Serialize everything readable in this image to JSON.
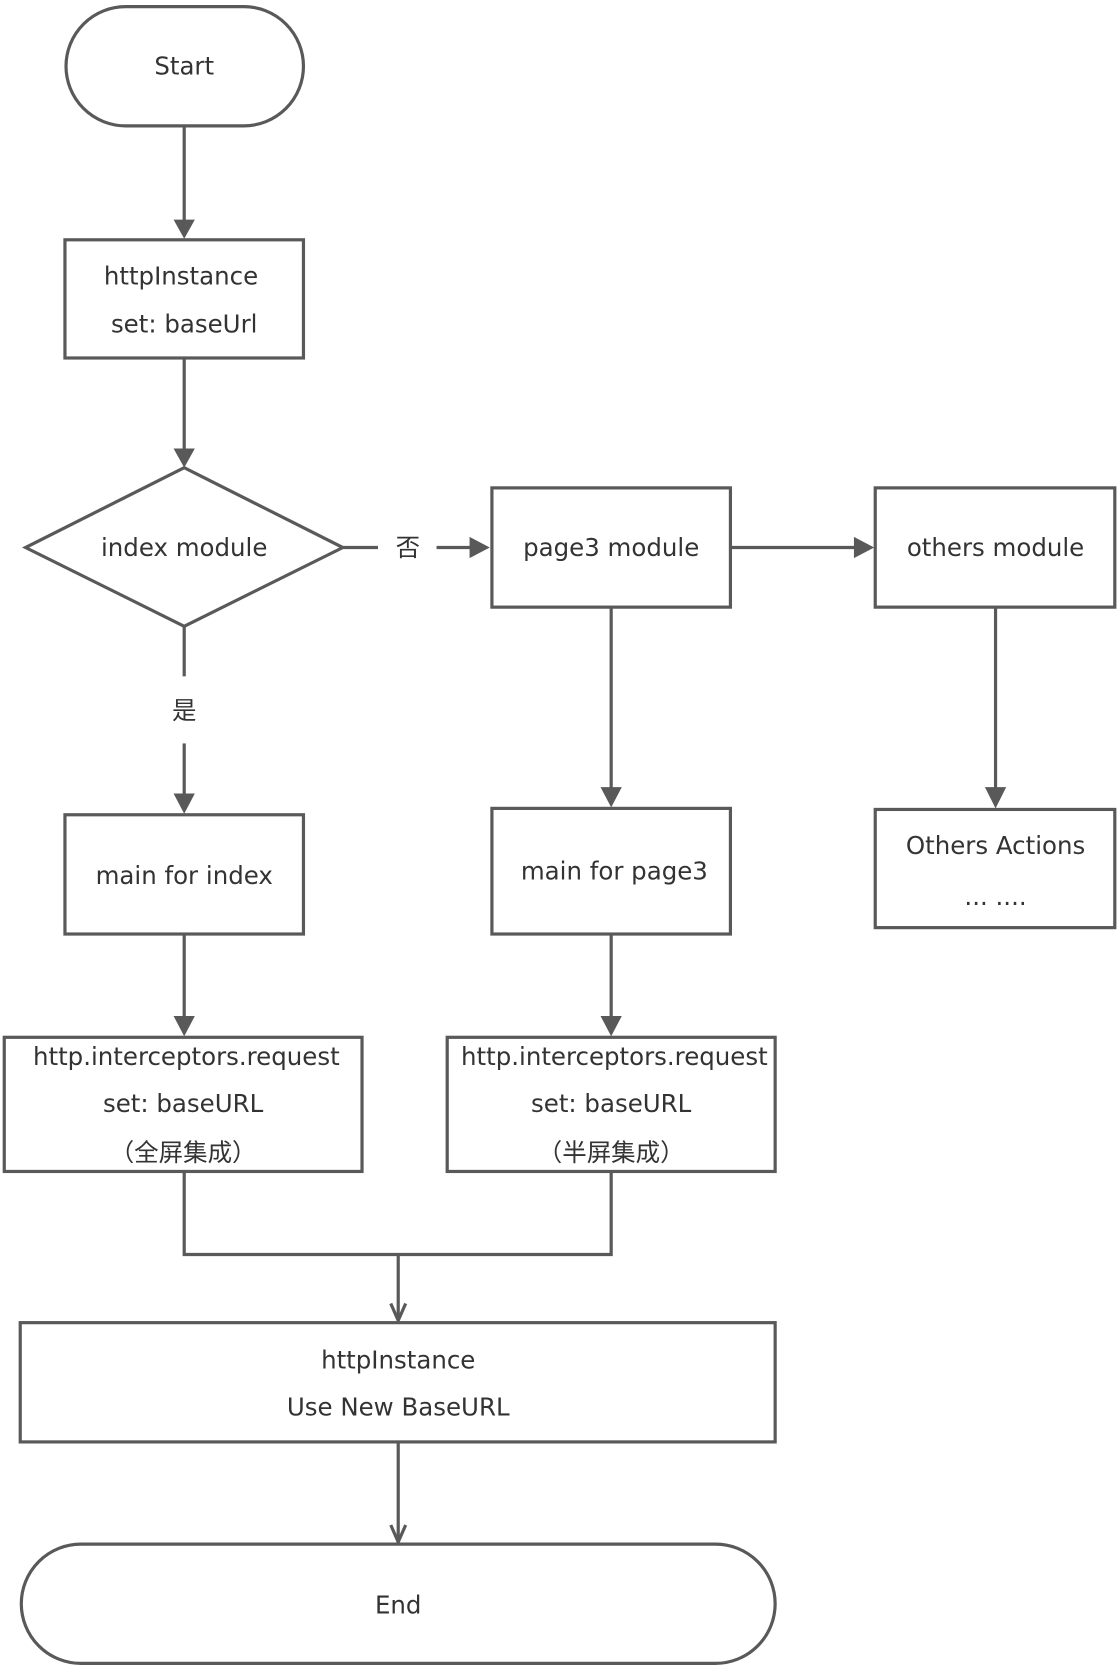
{
  "diagram": {
    "type": "flowchart",
    "line_color": "#595959",
    "text_color": "#333333",
    "nodes": {
      "start": {
        "lines": [
          "Start"
        ]
      },
      "http_instance": {
        "lines": [
          "httpInstance",
          "set: baseUrl"
        ]
      },
      "index_module": {
        "lines": [
          "index module"
        ]
      },
      "page3_module": {
        "lines": [
          "page3 module"
        ]
      },
      "others_module": {
        "lines": [
          "others module"
        ]
      },
      "main_index": {
        "lines": [
          "main for index"
        ]
      },
      "main_page3": {
        "lines": [
          "main for page3"
        ]
      },
      "others_actions": {
        "lines": [
          "Others Actions",
          "... ...."
        ]
      },
      "interceptor_full": {
        "lines": [
          "http.interceptors.request",
          "set: baseURL",
          "（全屏集成）"
        ]
      },
      "interceptor_half": {
        "lines": [
          "http.interceptors.request",
          "set: baseURL",
          "（半屏集成）"
        ]
      },
      "http_new": {
        "lines": [
          "httpInstance",
          "Use New BaseURL"
        ]
      },
      "end": {
        "lines": [
          "End"
        ]
      }
    },
    "edge_labels": {
      "no": "否",
      "yes": "是"
    }
  }
}
